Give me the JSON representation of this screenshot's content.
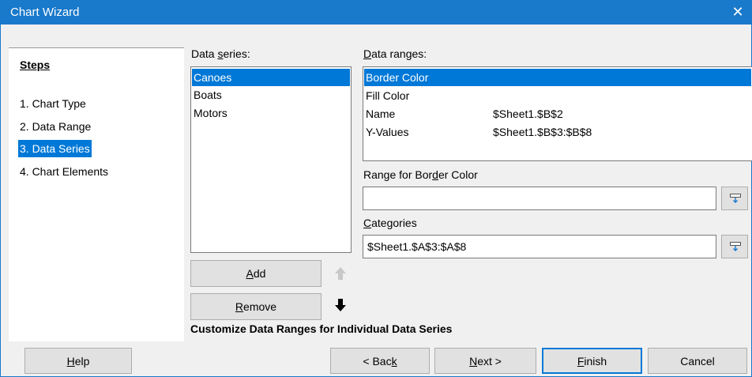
{
  "window": {
    "title": "Chart Wizard"
  },
  "steps": {
    "heading": "Steps",
    "items": [
      {
        "label": "1. Chart Type",
        "selected": false
      },
      {
        "label": "2. Data Range",
        "selected": false
      },
      {
        "label": "3. Data Series",
        "selected": true
      },
      {
        "label": "4. Chart Elements",
        "selected": false
      }
    ]
  },
  "data_series": {
    "label_pre": "Data ",
    "label_accel": "s",
    "label_post": "eries:",
    "items": [
      "Canoes",
      "Boats",
      "Motors"
    ],
    "selected": "Canoes",
    "add_accel": "A",
    "add_rest": "dd",
    "remove_accel": "R",
    "remove_rest": "emove"
  },
  "data_ranges": {
    "label_accel": "D",
    "label_rest": "ata ranges:",
    "rows": [
      {
        "role": "Border Color",
        "range": ""
      },
      {
        "role": "Fill Color",
        "range": ""
      },
      {
        "role": "Name",
        "range": "$Sheet1.$B$2"
      },
      {
        "role": "Y-Values",
        "range": "$Sheet1.$B$3:$B$8"
      }
    ],
    "selected": "Border Color"
  },
  "range_for": {
    "label_pre": "Range for Bor",
    "label_accel": "d",
    "label_post": "er Color",
    "value": ""
  },
  "categories": {
    "label_accel": "C",
    "label_rest": "ategories",
    "value": "$Sheet1.$A$3:$A$8"
  },
  "hint": "Customize Data Ranges for Individual Data Series",
  "buttons": {
    "help_accel": "H",
    "help_rest": "elp",
    "back_pre": "< Bac",
    "back_accel": "k",
    "next_accel": "N",
    "next_rest": "ext >",
    "finish_accel": "F",
    "finish_rest": "inish",
    "cancel": "Cancel"
  },
  "colors": {
    "accent": "#1979ca",
    "selection": "#0078d7"
  }
}
